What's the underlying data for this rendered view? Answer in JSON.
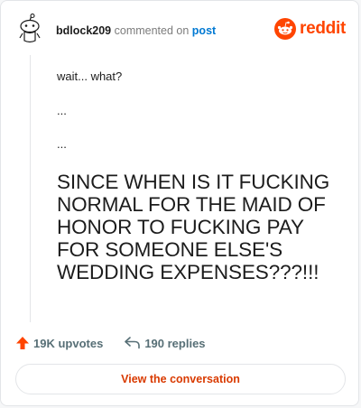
{
  "header": {
    "username": "bdlock209",
    "action_text": "commented on",
    "post_link": "post",
    "brand": "reddit",
    "brand_color": "#ff4500",
    "avatar_icon": "snoo-avatar-icon"
  },
  "comment": {
    "line1": "wait... what?",
    "line2": "...",
    "line3": "...",
    "big_line1": "SINCE WHEN IS IT FUCKING",
    "big_line2": "NORMAL FOR THE MAID OF",
    "big_line3": "HONOR TO FUCKING PAY",
    "big_line4": "FOR SOMEONE ELSE'S",
    "big_line5": "WEDDING EXPENSES???!!!"
  },
  "stats": {
    "upvotes": "19K upvotes",
    "upvote_icon": "upvote-arrow-icon",
    "replies": "190 replies",
    "reply_icon": "reply-arrow-icon"
  },
  "cta": {
    "label": "View the conversation",
    "color": "#d93a00"
  }
}
